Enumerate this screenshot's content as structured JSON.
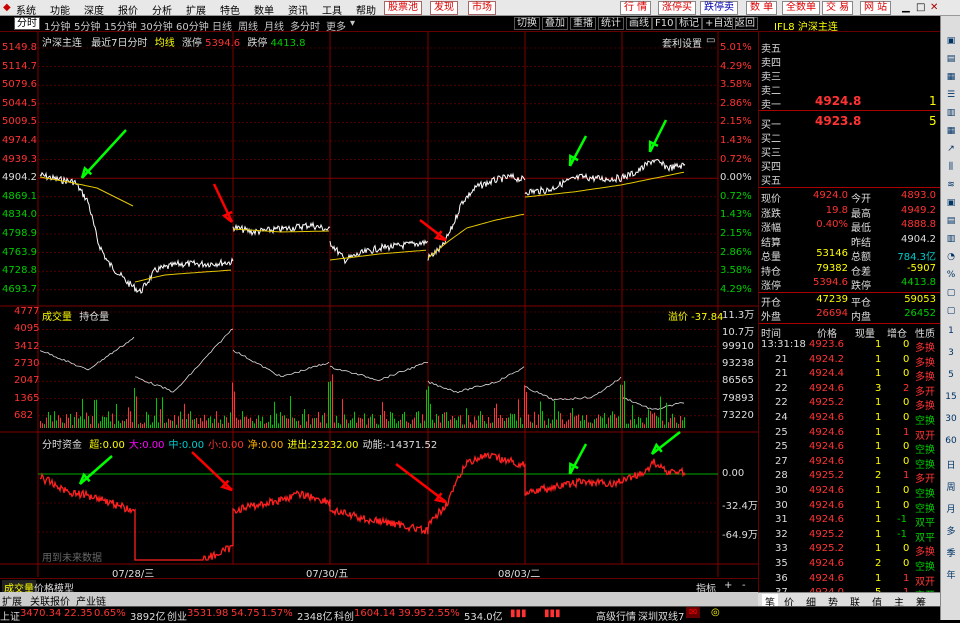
{
  "menu": {
    "items": [
      "系统",
      "功能",
      "深度",
      "报价",
      "分析",
      "扩展",
      "特色",
      "数单",
      "资讯",
      "工具",
      "帮助"
    ],
    "pool": "股票池",
    "find": "发现",
    "market": "市场",
    "right_items": [
      "行 情",
      "涨停买",
      "跌停卖",
      "数 单",
      "全数单",
      "交 易",
      "网 站"
    ]
  },
  "toolbar": {
    "periods": [
      "分时",
      "1分钟",
      "5分钟",
      "15分钟",
      "30分钟",
      "60分钟",
      "日线",
      "周线",
      "月线",
      "多分时",
      "更多"
    ],
    "buttons": [
      "切换",
      "叠加",
      "重播",
      "统计",
      "画线",
      "F10",
      "标记",
      "+自选",
      "返回"
    ]
  },
  "chart": {
    "title": "沪深主连",
    "subtitle": "最近7日分时",
    "avg_label": "均线",
    "limit_up_label": "涨停",
    "limit_up": "5394.6",
    "limit_down_label": "跌停",
    "limit_down": "4413.8",
    "settings": "套利设置",
    "vol_label": "成交量",
    "oi_label": "持仓量",
    "spread_label": "溢价 -37.84",
    "price_ticks": [
      "5149.8",
      "5114.7",
      "5079.6",
      "5044.5",
      "5009.5",
      "4974.4",
      "4939.3",
      "4904.2",
      "4869.1",
      "4834.0",
      "4798.9",
      "4763.9",
      "4728.8",
      "4693.7"
    ],
    "pct_ticks": [
      "5.01%",
      "4.29%",
      "3.58%",
      "2.86%",
      "2.15%",
      "1.43%",
      "0.72%",
      "0.00%",
      "0.72%",
      "1.43%",
      "2.15%",
      "2.86%",
      "3.58%",
      "4.29%"
    ],
    "vol_ticks": [
      "4777",
      "4095",
      "3412",
      "2730",
      "2047",
      "1365",
      "682"
    ],
    "oi_ticks": [
      "11.3万",
      "10.7万",
      "99910",
      "93238",
      "86565",
      "79893",
      "73220"
    ],
    "flow_title": "分时资金",
    "flow_items": [
      {
        "k": "超:",
        "v": "0.00"
      },
      {
        "k": "大:",
        "v": "0.00"
      },
      {
        "k": "中:",
        "v": "0.00"
      },
      {
        "k": "小:",
        "v": "0.00"
      },
      {
        "k": "净:",
        "v": "0.00"
      },
      {
        "k": "进出:",
        "v": "23232.00"
      },
      {
        "k": "动能:",
        "v": "-14371.52"
      }
    ],
    "flow_ticks": [
      "0.00",
      "-32.4万",
      "-64.9万"
    ],
    "flow_note": "用到未来数据",
    "dates": [
      "07/28/三",
      "07/30/五",
      "08/03/二"
    ],
    "bottom_tabs": [
      "成交量",
      "价格模型"
    ],
    "bottom_tabs2": [
      "扩展",
      "关联报价",
      "产业链"
    ],
    "bottom_right": [
      "指标",
      "+",
      "-"
    ]
  },
  "quote": {
    "name": "IFL8 沪深主连",
    "sell": [
      "卖五",
      "卖四",
      "卖三",
      "卖二",
      "卖一"
    ],
    "sell1_price": "4924.8",
    "sell1_vol": "1",
    "buy": [
      "买一",
      "买二",
      "买三",
      "买四",
      "买五"
    ],
    "buy1_price": "4923.8",
    "buy1_vol": "5",
    "stats": [
      {
        "a": "现价",
        "b": "4924.0",
        "c": "今开",
        "d": "4893.0"
      },
      {
        "a": "涨跌",
        "b": "19.8",
        "c": "最高",
        "d": "4949.2"
      },
      {
        "a": "涨幅",
        "b": "0.40%",
        "c": "最低",
        "d": "4888.8"
      },
      {
        "a": "结算",
        "b": "",
        "c": "昨结",
        "d": "4904.2"
      },
      {
        "a": "总量",
        "b": "53146",
        "c": "总额",
        "d": "784.3亿"
      },
      {
        "a": "持仓",
        "b": "79382",
        "c": "仓差",
        "d": "-5907"
      },
      {
        "a": "涨停",
        "b": "5394.6",
        "c": "跌停",
        "d": "4413.8"
      }
    ],
    "stats2": [
      {
        "a": "开仓",
        "b": "47239",
        "c": "平仓",
        "d": "59053"
      },
      {
        "a": "外盘",
        "b": "26694",
        "c": "内盘",
        "d": "26452"
      }
    ],
    "tick_header": [
      "时间",
      "价格",
      "现量",
      "增仓",
      "性质"
    ],
    "ticks": [
      [
        "13:31:18",
        "4923.6",
        "1",
        "0",
        "多换"
      ],
      [
        "21",
        "4924.2",
        "1",
        "0",
        "多换"
      ],
      [
        "21",
        "4924.4",
        "1",
        "0",
        "多换"
      ],
      [
        "22",
        "4924.6",
        "3",
        "2",
        "多开"
      ],
      [
        "22",
        "4925.2",
        "1",
        "0",
        "多换"
      ],
      [
        "24",
        "4924.6",
        "1",
        "0",
        "空换"
      ],
      [
        "25",
        "4924.6",
        "1",
        "1",
        "双开"
      ],
      [
        "25",
        "4924.6",
        "1",
        "0",
        "空换"
      ],
      [
        "27",
        "4924.6",
        "1",
        "0",
        "空换"
      ],
      [
        "28",
        "4925.2",
        "2",
        "1",
        "多开"
      ],
      [
        "30",
        "4924.6",
        "1",
        "0",
        "空换"
      ],
      [
        "30",
        "4924.6",
        "1",
        "0",
        "空换"
      ],
      [
        "31",
        "4924.6",
        "1",
        "-1",
        "双平"
      ],
      [
        "32",
        "4925.2",
        "1",
        "-1",
        "双平"
      ],
      [
        "33",
        "4925.2",
        "1",
        "0",
        "多换"
      ],
      [
        "35",
        "4924.6",
        "2",
        "0",
        "空换"
      ],
      [
        "36",
        "4924.6",
        "1",
        "1",
        "双开"
      ],
      [
        "37",
        "4924.0",
        "5",
        "1",
        "空开"
      ]
    ],
    "bottom_tabs": [
      "笔",
      "价",
      "细",
      "势",
      "联",
      "值",
      "主",
      "筹"
    ]
  },
  "side_icons": [
    "window-icon",
    "chart-icon",
    "grid-icon",
    "list-icon",
    "bars-icon",
    "table-icon",
    "trend-icon",
    "kline-icon",
    "flow-icon",
    "book-icon",
    "doc-icon",
    "stat-icon",
    "pie-icon",
    "percent-icon",
    "box-icon",
    "box2-icon",
    "one",
    "three",
    "five",
    "fifteen",
    "thirty",
    "sixty",
    "day",
    "week",
    "month",
    "multi",
    "season",
    "year"
  ],
  "side_labels": [
    "1",
    "3",
    "5",
    "15",
    "30",
    "60",
    "日",
    "周",
    "月",
    "多",
    "季",
    "年"
  ],
  "status": [
    {
      "n": "上证",
      "v": "3470.34",
      "d": "22.35",
      "p": "0.65%",
      "a": "3892亿"
    },
    {
      "n": "创业",
      "v": "3531.98",
      "d": "54.75",
      "p": "1.57%",
      "a": "2348亿"
    },
    {
      "n": "科创",
      "v": "1604.14",
      "d": "39.95",
      "p": "2.55%",
      "a": "534.0亿"
    }
  ],
  "status_right": [
    "高级行情",
    "深圳双线7"
  ],
  "colors": {
    "price": "#ffffff",
    "avg": "#e6c800",
    "flow": "#ff2020",
    "up": "#ff3333",
    "down": "#00c800",
    "grid": "#800000",
    "arrow_green": "#00ff00",
    "arrow_red": "#ff0000"
  }
}
